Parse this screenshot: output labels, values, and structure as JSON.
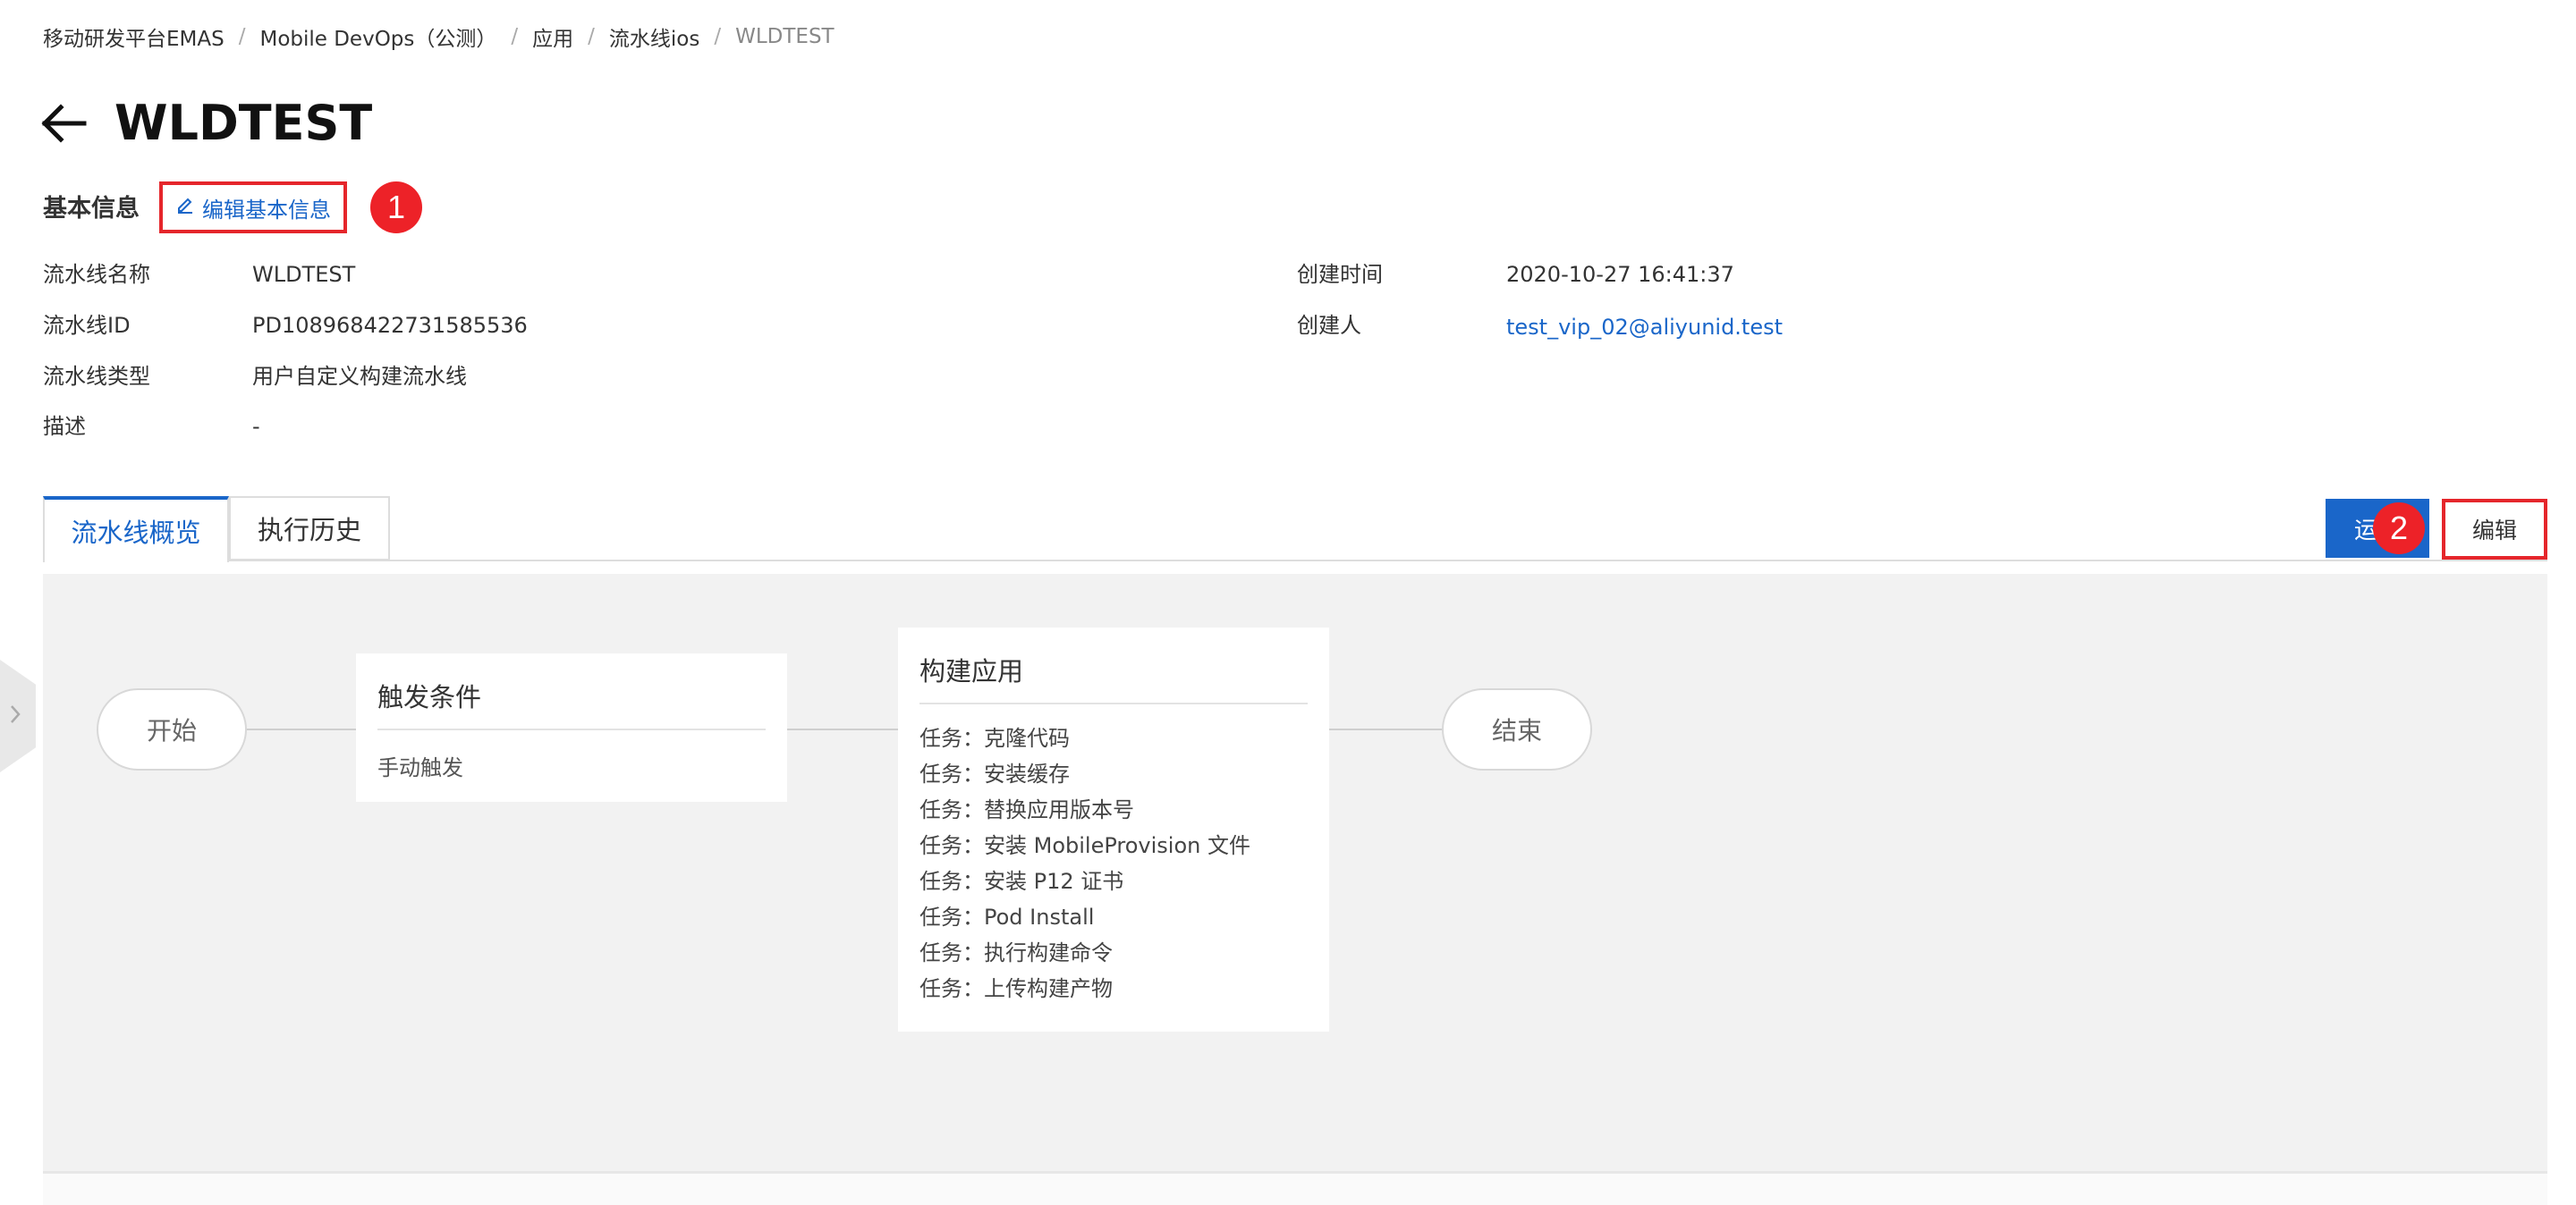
{
  "breadcrumb": {
    "items": [
      "移动研发平台EMAS",
      "Mobile DevOps（公测）",
      "应用",
      "流水线ios",
      "WLDTEST"
    ],
    "separator": "/"
  },
  "header": {
    "title": "WLDTEST"
  },
  "basic_info": {
    "section_title": "基本信息",
    "edit_link_label": "编辑基本信息",
    "left": [
      {
        "label": "流水线名称",
        "value": "WLDTEST"
      },
      {
        "label": "流水线ID",
        "value": "PD108968422731585536"
      },
      {
        "label": "流水线类型",
        "value": "用户自定义构建流水线"
      },
      {
        "label": "描述",
        "value": "-"
      }
    ],
    "right": [
      {
        "label": "创建时间",
        "value": "2020-10-27 16:41:37"
      },
      {
        "label": "创建人",
        "value": "test_vip_02@aliyunid.test"
      }
    ]
  },
  "annotations": {
    "marker_1": "1",
    "marker_2": "2",
    "color": "#ed2228"
  },
  "tabs": [
    {
      "label": "流水线概览",
      "active": true
    },
    {
      "label": "执行历史",
      "active": false
    }
  ],
  "actions": {
    "run_label": "运行",
    "edit_label": "编辑"
  },
  "pipeline": {
    "start_label": "开始",
    "end_label": "结束",
    "trigger": {
      "title": "触发条件",
      "text": "手动触发"
    },
    "build": {
      "title": "构建应用",
      "tasks": [
        "任务：克隆代码",
        "任务：安装缓存",
        "任务：替换应用版本号",
        "任务：安装 MobileProvision 文件",
        "任务：安装 P12 证书",
        "任务：Pod Install",
        "任务：执行构建命令",
        "任务：上传构建产物"
      ]
    }
  },
  "icons": {
    "back": "arrow-left-icon",
    "edit": "pencil-icon",
    "side_toggle": "chevron-right-icon"
  },
  "colors": {
    "accent": "#1a66c9",
    "highlight_border": "#e5262b",
    "canvas_bg": "#f2f2f2"
  }
}
